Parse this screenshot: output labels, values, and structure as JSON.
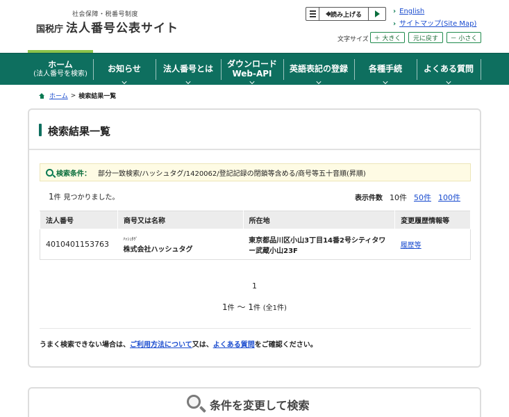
{
  "header": {
    "logo_sub": "社会保障・税番号制度",
    "logo_agency": "国税庁",
    "logo_main": "法人番号公表サイト",
    "read_aloud_label": "読み上げる",
    "english_link": "English",
    "sitemap_link": "サイトマップ(Site Map)",
    "font_size_label": "文字サイズ",
    "font_larger": "＋ 大きく",
    "font_reset": "元に戻す",
    "font_smaller": "－ 小さく"
  },
  "nav": {
    "home": "ホーム",
    "home_sub": "(法人番号を検索)",
    "news": "お知らせ",
    "about": "法人番号とは",
    "download_1": "ダウンロード",
    "download_2": "Web-API",
    "english_reg": "英語表記の登録",
    "procedures": "各種手続",
    "faq": "よくある質問"
  },
  "breadcrumb": {
    "home": "ホーム",
    "separator": ">",
    "current": "検索結果一覧"
  },
  "results": {
    "title": "検索結果一覧",
    "condition_label": "検索条件：",
    "condition_value": "部分一致検索/ハッシュタグ/1420062/登記記録の閉鎖等含める/商号等五十音順(昇順)",
    "count_num": "1",
    "count_unit": "件",
    "count_text": "見つかりました。",
    "per_page_label": "表示件数",
    "per_page_current": "10件",
    "per_page_50": "50件",
    "per_page_100": "100件",
    "columns": {
      "number": "法人番号",
      "name": "商号又は名称",
      "address": "所在地",
      "history": "変更履歴情報等"
    },
    "rows": [
      {
        "number": "4010401153763",
        "name_kana": "ﾊｯｼｭﾀｸﾞ",
        "name": "株式会社ハッシュタグ",
        "address_1": "東京都品川区小山3丁目14番2号シティタワ",
        "address_2": "ー武蔵小山23F",
        "history": "履歴等"
      }
    ],
    "page_number": "1",
    "range_start": "1",
    "range_unit": "件",
    "range_sep": " ～ ",
    "range_end": "1",
    "range_total": "(全1件)",
    "help_prefix": "うまく検索できない場合は、",
    "help_link1": "ご利用方法について",
    "help_mid": "又は、",
    "help_link2": "よくある質問",
    "help_suffix": "をご確認ください。"
  },
  "search_change": {
    "title": "条件を変更して検索"
  }
}
